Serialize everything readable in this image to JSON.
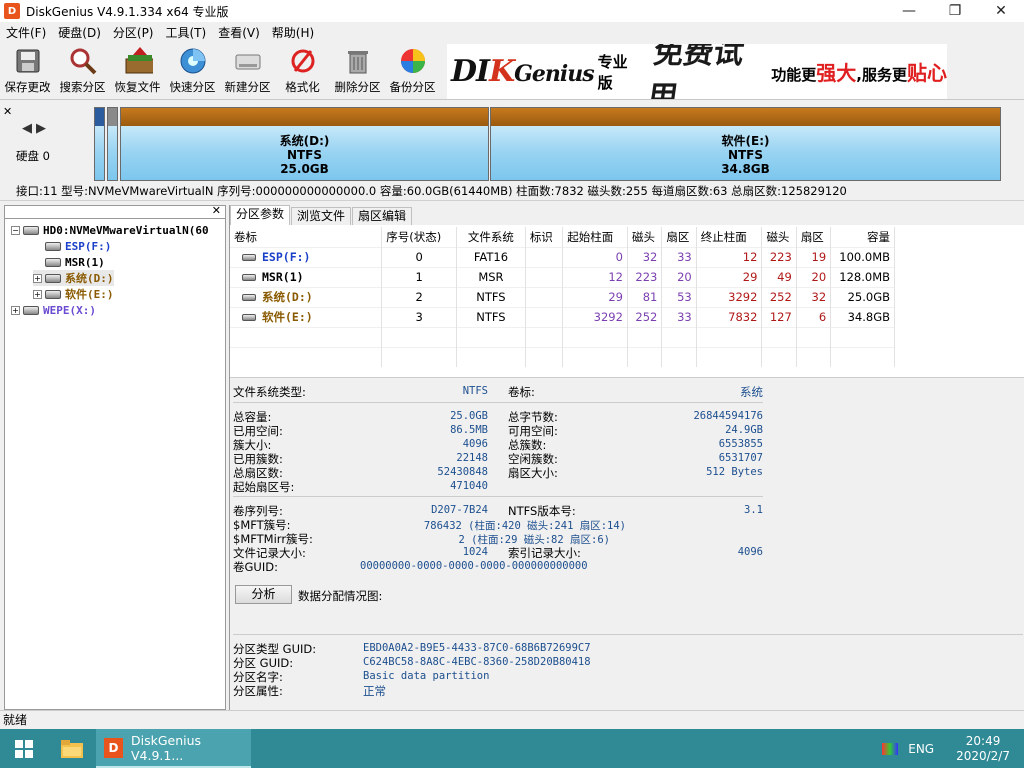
{
  "window": {
    "title": "DiskGenius V4.9.1.334 x64 专业版",
    "app_icon": "D",
    "minimize_icon": "minimize-icon",
    "maximize_icon": "restore-icon",
    "close_icon": "close-icon"
  },
  "menu": [
    "文件(F)",
    "硬盘(D)",
    "分区(P)",
    "工具(T)",
    "查看(V)",
    "帮助(H)"
  ],
  "toolbar": [
    {
      "label": "保存更改",
      "icon": "save-icon"
    },
    {
      "label": "搜索分区",
      "icon": "search-icon"
    },
    {
      "label": "恢复文件",
      "icon": "recover-icon"
    },
    {
      "label": "快速分区",
      "icon": "quick-partition-icon"
    },
    {
      "label": "新建分区",
      "icon": "new-partition-icon"
    },
    {
      "label": "格式化",
      "icon": "format-icon"
    },
    {
      "label": "删除分区",
      "icon": "delete-icon"
    },
    {
      "label": "备份分区",
      "icon": "backup-icon"
    }
  ],
  "banner": {
    "brand_a": "DI",
    "brand_b": "K",
    "brand_c": "Genius",
    "edition": "专业版",
    "slogan": "免费试用",
    "tag_pre": "功能更",
    "tag_red1": "强大",
    "tag_mid": ",服务更",
    "tag_red2": "贴心"
  },
  "disk_map": {
    "disk_label": "硬盘 0",
    "partitions": [
      {
        "name": "系统(D:)",
        "fs": "NTFS",
        "size": "25.0GB"
      },
      {
        "name": "软件(E:)",
        "fs": "NTFS",
        "size": "34.8GB"
      }
    ]
  },
  "disk_info": "接口:11  型号:NVMeVMwareVirtualN  序列号:000000000000000.0  容量:60.0GB(61440MB)  柱面数:7832  磁头数:255  每道扇区数:63  总扇区数:125829120",
  "tree": {
    "disk": "HD0:NVMeVMwareVirtualN(60",
    "items": [
      {
        "label": "ESP(F:)",
        "color": "#1a3fc8"
      },
      {
        "label": "MSR(1)",
        "color": "#000000"
      },
      {
        "label": "系统(D:)",
        "color": "#8a5a00"
      },
      {
        "label": "软件(E:)",
        "color": "#8a5a00"
      }
    ],
    "wepe": "WEPE(X:)"
  },
  "tabs": [
    "分区参数",
    "浏览文件",
    "扇区编辑"
  ],
  "table": {
    "headers": [
      "卷标",
      "序号(状态)",
      "文件系统",
      "标识",
      "起始柱面",
      "磁头",
      "扇区",
      "终止柱面",
      "磁头",
      "扇区",
      "容量"
    ],
    "rows": [
      {
        "vol": "ESP(F:)",
        "idx": "0",
        "fs": "FAT16",
        "flag": "",
        "sc": "0",
        "sh": "32",
        "ss": "33",
        "ec": "12",
        "eh": "223",
        "es": "19",
        "cap": "100.0MB"
      },
      {
        "vol": "MSR(1)",
        "idx": "1",
        "fs": "MSR",
        "flag": "",
        "sc": "12",
        "sh": "223",
        "ss": "20",
        "ec": "29",
        "eh": "49",
        "es": "20",
        "cap": "128.0MB"
      },
      {
        "vol": "系统(D:)",
        "idx": "2",
        "fs": "NTFS",
        "flag": "",
        "sc": "29",
        "sh": "81",
        "ss": "53",
        "ec": "3292",
        "eh": "252",
        "es": "32",
        "cap": "25.0GB"
      },
      {
        "vol": "软件(E:)",
        "idx": "3",
        "fs": "NTFS",
        "flag": "",
        "sc": "3292",
        "sh": "252",
        "ss": "33",
        "ec": "7832",
        "eh": "127",
        "es": "6",
        "cap": "34.8GB"
      }
    ]
  },
  "details": {
    "fs_type_label": "文件系统类型:",
    "fs_type": "NTFS",
    "vol_label_label": "卷标:",
    "vol_label": "系统",
    "total_cap_label": "总容量:",
    "total_cap": "25.0GB",
    "total_bytes_label": "总字节数:",
    "total_bytes": "26844594176",
    "used_label": "已用空间:",
    "used": "86.5MB",
    "free_label": "可用空间:",
    "free": "24.9GB",
    "cluster_size_label": "簇大小:",
    "cluster_size": "4096",
    "total_clusters_label": "总簇数:",
    "total_clusters": "6553855",
    "used_clusters_label": "已用簇数:",
    "used_clusters": "22148",
    "free_clusters_label": "空闲簇数:",
    "free_clusters": "6531707",
    "total_sectors_label": "总扇区数:",
    "total_sectors": "52430848",
    "sector_size_label": "扇区大小:",
    "sector_size": "512 Bytes",
    "start_sector_label": "起始扇区号:",
    "start_sector": "471040",
    "serial_label": "卷序列号:",
    "serial": "D207-7B24",
    "ntfs_ver_label": "NTFS版本号:",
    "ntfs_ver": "3.1",
    "mft_label": "$MFT簇号:",
    "mft": "786432 (柱面:420 磁头:241 扇区:14)",
    "mftmirr_label": "$MFTMirr簇号:",
    "mftmirr": "2 (柱面:29 磁头:82 扇区:6)",
    "record_size_label": "文件记录大小:",
    "record_size": "1024",
    "index_size_label": "索引记录大小:",
    "index_size": "4096",
    "guid_label": "卷GUID:",
    "guid": "00000000-0000-0000-0000-000000000000",
    "analyze_btn": "分析",
    "alloc_label": "数据分配情况图:",
    "ptype_label": "分区类型 GUID:",
    "ptype": "EBD0A0A2-B9E5-4433-87C0-68B6B72699C7",
    "pguid_label": "分区 GUID:",
    "pguid": "C624BC58-8A8C-4EBC-8360-258D20B80418",
    "pname_label": "分区名字:",
    "pname": "Basic data partition",
    "pattr_label": "分区属性:",
    "pattr": "正常"
  },
  "status": "就绪",
  "taskbar": {
    "app": "DiskGenius V4.9.1...",
    "lang": "ENG",
    "time": "20:49",
    "date": "2020/2/7"
  }
}
